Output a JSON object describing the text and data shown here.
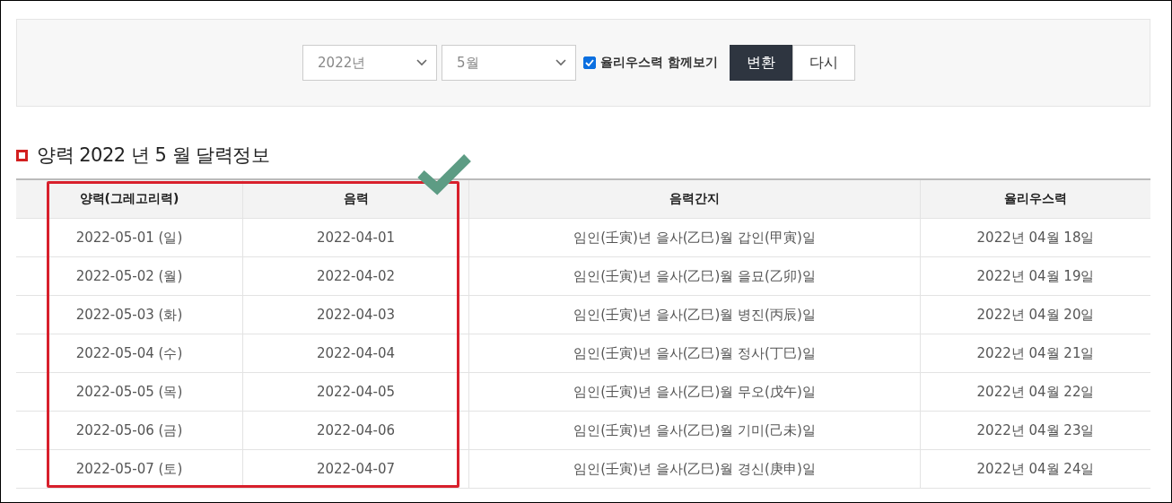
{
  "form": {
    "year": {
      "value": "2022년"
    },
    "month": {
      "value": "5월"
    },
    "julian_option": {
      "label": "율리우스력 함께보기",
      "checked": true
    },
    "buttons": [
      {
        "label": "변환",
        "kind": "primary"
      },
      {
        "label": "다시",
        "kind": "secondary"
      }
    ]
  },
  "heading": "양력 2022 년 5 월 달력정보",
  "table": {
    "columns": [
      "양력(그레고리력)",
      "음력",
      "음력간지",
      "율리우스력"
    ],
    "rows": [
      [
        "2022-05-01 (일)",
        "2022-04-01",
        "임인(壬寅)년 을사(乙巳)월 갑인(甲寅)일",
        "2022년 04월 18일"
      ],
      [
        "2022-05-02 (월)",
        "2022-04-02",
        "임인(壬寅)년 을사(乙巳)월 을묘(乙卯)일",
        "2022년 04월 19일"
      ],
      [
        "2022-05-03 (화)",
        "2022-04-03",
        "임인(壬寅)년 을사(乙巳)월 병진(丙辰)일",
        "2022년 04월 20일"
      ],
      [
        "2022-05-04 (수)",
        "2022-04-04",
        "임인(壬寅)년 을사(乙巳)월 정사(丁巳)일",
        "2022년 04월 21일"
      ],
      [
        "2022-05-05 (목)",
        "2022-04-05",
        "임인(壬寅)년 을사(乙巳)월 무오(戊午)일",
        "2022년 04월 22일"
      ],
      [
        "2022-05-06 (금)",
        "2022-04-06",
        "임인(壬寅)년 을사(乙巳)월 기미(己未)일",
        "2022년 04월 23일"
      ],
      [
        "2022-05-07 (토)",
        "2022-04-07",
        "임인(壬寅)년 을사(乙巳)월 경신(庚申)일",
        "2022년 04월 24일"
      ]
    ]
  }
}
